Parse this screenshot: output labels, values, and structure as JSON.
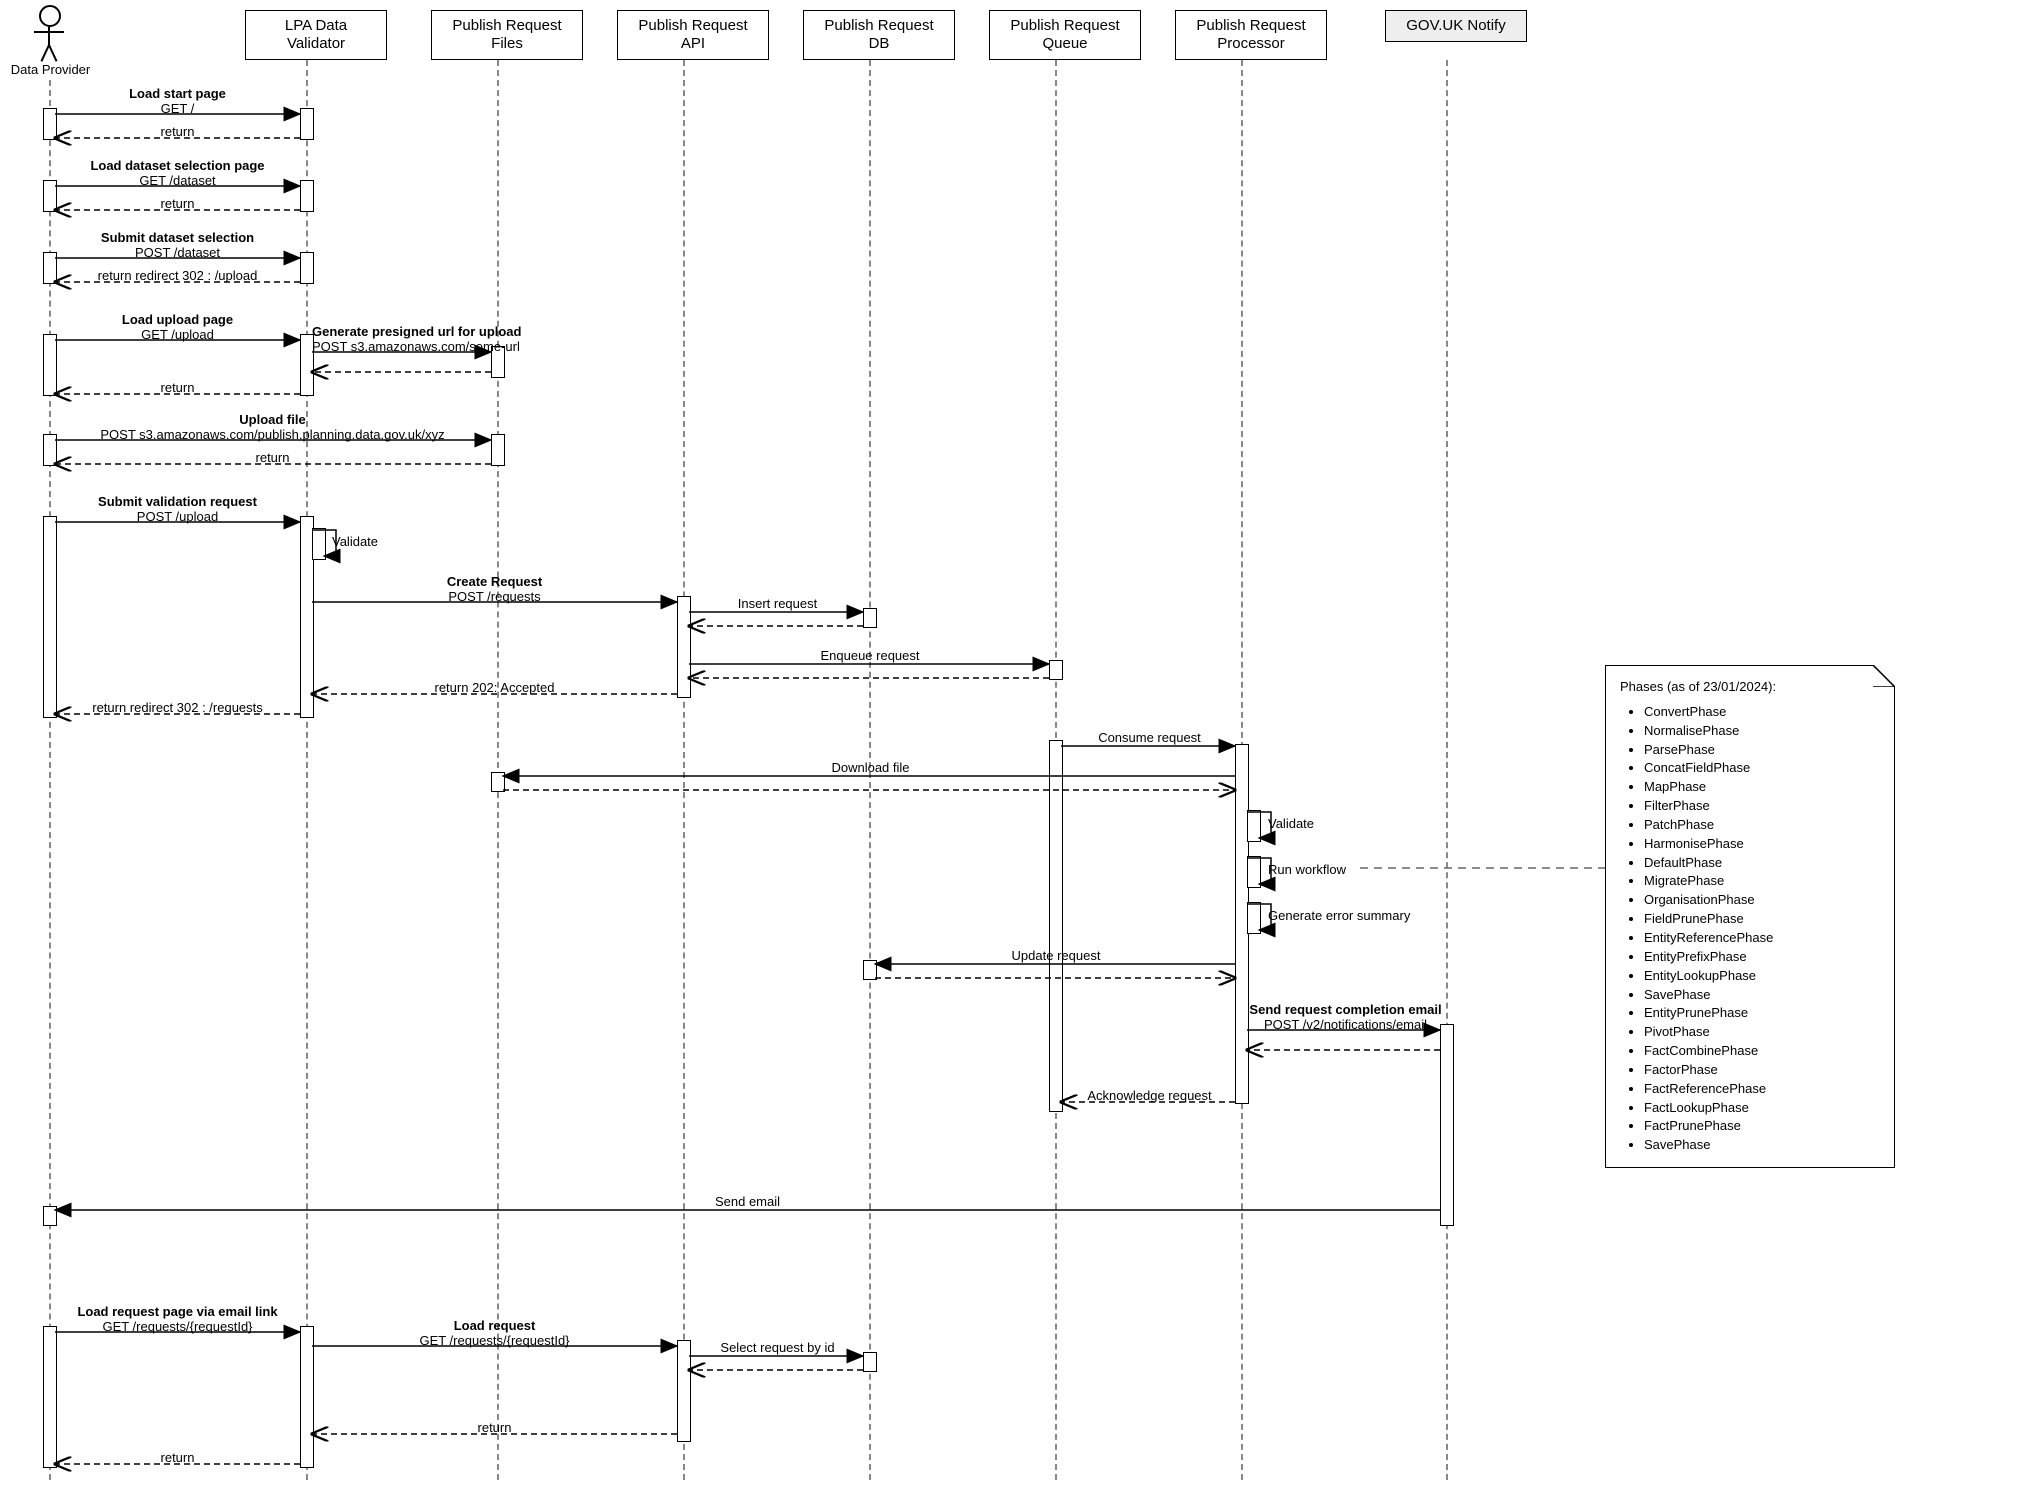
{
  "participants": {
    "actor": "Data Provider",
    "validator": "LPA Data\nValidator",
    "files": "Publish Request\nFiles",
    "api": "Publish Request\nAPI",
    "db": "Publish Request\nDB",
    "queue": "Publish Request\nQueue",
    "processor": "Publish Request\nProcessor",
    "notify": "GOV.UK Notify"
  },
  "messages": {
    "load_start_t": "Load start page",
    "load_start_s": "GET /",
    "return": "return",
    "load_ds_t": "Load dataset selection page",
    "load_ds_s": "GET /dataset",
    "submit_ds_t": "Submit dataset selection",
    "submit_ds_s": "POST /dataset",
    "redirect_upload": "return redirect 302 : /upload",
    "load_upload_t": "Load upload page",
    "load_upload_s": "GET /upload",
    "presigned_t": "Generate presigned url for upload",
    "presigned_s": "POST s3.amazonaws.com/some-url",
    "upload_file_t": "Upload file",
    "upload_file_s": "POST s3.amazonaws.com/publish.planning.data.gov.uk/xyz",
    "submit_val_t": "Submit validation request",
    "submit_val_s": "POST /upload",
    "self_validate": "Validate",
    "create_req_t": "Create Request",
    "create_req_s": "POST /requests",
    "insert_req": "Insert request",
    "enqueue_req": "Enqueue request",
    "ret_202": "return 202: Accepted",
    "redirect_requests": "return redirect 302 : /requests",
    "consume_req": "Consume request",
    "download_file": "Download file",
    "proc_validate": "Validate",
    "run_workflow": "Run workflow",
    "gen_err": "Generate error summary",
    "update_req": "Update request",
    "send_email_t": "Send request completion email",
    "send_email_s": "POST /v2/notifications/email",
    "ack_req": "Acknowledge request",
    "send_email_actor": "Send email",
    "load_req_page_t": "Load request page via email link",
    "load_req_page_s": "GET /requests/{requestId}",
    "load_req_t": "Load request",
    "load_req_s": "GET /requests/{requestId}",
    "select_by_id": "Select request by id"
  },
  "note": {
    "title": "Phases (as of 23/01/2024):",
    "phases": [
      "ConvertPhase",
      "NormalisePhase",
      "ParsePhase",
      "ConcatFieldPhase",
      "MapPhase",
      "FilterPhase",
      "PatchPhase",
      "HarmonisePhase",
      "DefaultPhase",
      "MigratePhase",
      "OrganisationPhase",
      "FieldPrunePhase",
      "EntityReferencePhase",
      "EntityPrefixPhase",
      "EntityLookupPhase",
      "SavePhase",
      "EntityPrunePhase",
      "PivotPhase",
      "FactCombinePhase",
      "FactorPhase",
      "FactReferencePhase",
      "FactLookupPhase",
      "FactPrunePhase",
      "SavePhase"
    ]
  }
}
